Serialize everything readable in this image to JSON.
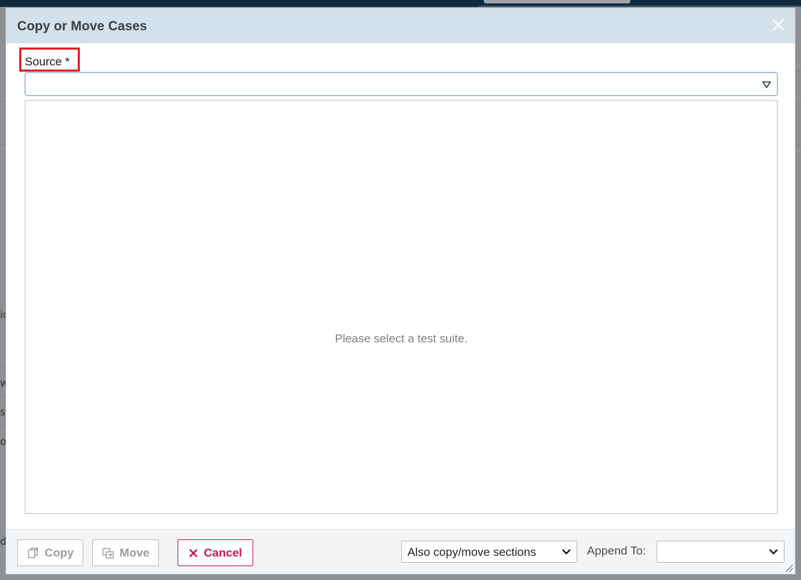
{
  "background": {
    "fragments": [
      "ic",
      "w",
      "s",
      "o",
      "d"
    ]
  },
  "dialog": {
    "title": "Copy or Move Cases",
    "close_icon": "close-icon",
    "source": {
      "label": "Source *",
      "value": ""
    },
    "suite_panel": {
      "empty_message": "Please select a test suite."
    },
    "footer": {
      "copy_label": "Copy",
      "move_label": "Move",
      "cancel_label": "Cancel",
      "sections_selected": "Also copy/move sections",
      "append_label": "Append To:",
      "append_value": ""
    }
  },
  "colors": {
    "header_bg": "#d4e1eb",
    "highlight_box": "#e01b24",
    "cancel_accent": "#c4175a",
    "select_focus": "#7fa7cf"
  }
}
